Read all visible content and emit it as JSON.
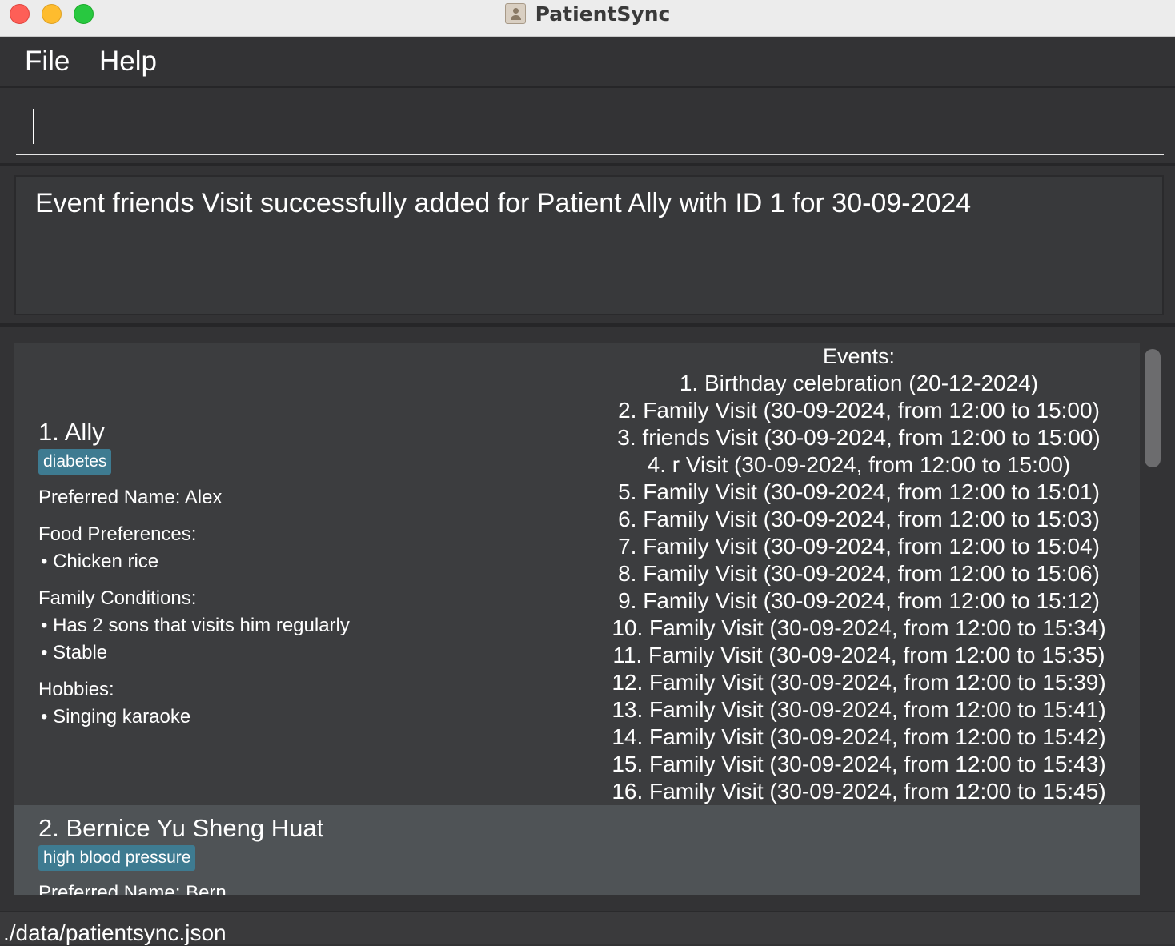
{
  "window": {
    "title": "PatientSync"
  },
  "menu": {
    "file": "File",
    "help": "Help"
  },
  "command": {
    "value": ""
  },
  "result": {
    "message": "Event friends Visit successfully added for Patient Ally with ID 1 for 30-09-2024"
  },
  "patients": [
    {
      "name": "1.  Ally",
      "tag": "diabetes",
      "preferred_name": "Preferred Name:  Alex",
      "food_label": "Food Preferences:",
      "food": [
        "Chicken rice"
      ],
      "family_label": "Family Conditions:",
      "family": [
        "Has 2 sons that visits him regularly",
        "Stable"
      ],
      "hobbies_label": "Hobbies:",
      "hobbies": [
        "Singing karaoke"
      ],
      "events_label": "Events:",
      "events": [
        "1. Birthday celebration (20-12-2024)",
        "2. Family Visit (30-09-2024, from 12:00 to 15:00)",
        "3. friends Visit (30-09-2024, from 12:00 to 15:00)",
        "4. r Visit (30-09-2024, from 12:00 to 15:00)",
        "5. Family Visit (30-09-2024, from 12:00 to 15:01)",
        "6. Family Visit (30-09-2024, from 12:00 to 15:03)",
        "7. Family Visit (30-09-2024, from 12:00 to 15:04)",
        "8. Family Visit (30-09-2024, from 12:00 to 15:06)",
        "9. Family Visit (30-09-2024, from 12:00 to 15:12)",
        "10. Family Visit (30-09-2024, from 12:00 to 15:34)",
        "11. Family Visit (30-09-2024, from 12:00 to 15:35)",
        "12. Family Visit (30-09-2024, from 12:00 to 15:39)",
        "13. Family Visit (30-09-2024, from 12:00 to 15:41)",
        "14. Family Visit (30-09-2024, from 12:00 to 15:42)",
        "15. Family Visit (30-09-2024, from 12:00 to 15:43)",
        "16. Family Visit (30-09-2024, from 12:00 to 15:45)"
      ]
    },
    {
      "name": "2.  Bernice Yu Sheng Huat",
      "tag": "high blood pressure",
      "preferred_name": "Preferred Name:  Bern"
    }
  ],
  "status_bar": {
    "path": "./data/patientsync.json"
  },
  "colors": {
    "background": "#333335",
    "tag": "#3e7b91",
    "selected_card": "#4f5356",
    "titlebar": "#ececec"
  },
  "icons": {
    "app": "contact-card-icon"
  }
}
